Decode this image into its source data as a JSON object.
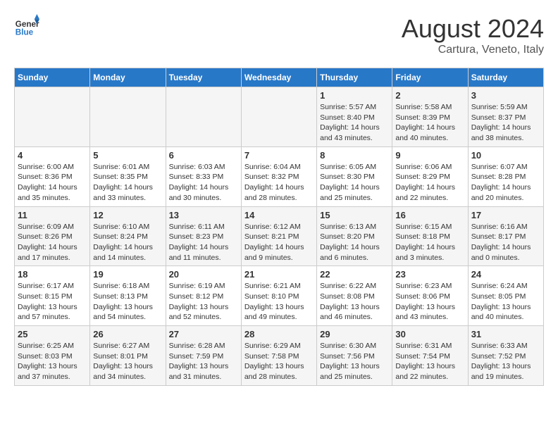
{
  "header": {
    "logo_line1": "General",
    "logo_line2": "Blue",
    "month": "August 2024",
    "location": "Cartura, Veneto, Italy"
  },
  "weekdays": [
    "Sunday",
    "Monday",
    "Tuesday",
    "Wednesday",
    "Thursday",
    "Friday",
    "Saturday"
  ],
  "weeks": [
    [
      {
        "day": "",
        "info": ""
      },
      {
        "day": "",
        "info": ""
      },
      {
        "day": "",
        "info": ""
      },
      {
        "day": "",
        "info": ""
      },
      {
        "day": "1",
        "info": "Sunrise: 5:57 AM\nSunset: 8:40 PM\nDaylight: 14 hours\nand 43 minutes."
      },
      {
        "day": "2",
        "info": "Sunrise: 5:58 AM\nSunset: 8:39 PM\nDaylight: 14 hours\nand 40 minutes."
      },
      {
        "day": "3",
        "info": "Sunrise: 5:59 AM\nSunset: 8:37 PM\nDaylight: 14 hours\nand 38 minutes."
      }
    ],
    [
      {
        "day": "4",
        "info": "Sunrise: 6:00 AM\nSunset: 8:36 PM\nDaylight: 14 hours\nand 35 minutes."
      },
      {
        "day": "5",
        "info": "Sunrise: 6:01 AM\nSunset: 8:35 PM\nDaylight: 14 hours\nand 33 minutes."
      },
      {
        "day": "6",
        "info": "Sunrise: 6:03 AM\nSunset: 8:33 PM\nDaylight: 14 hours\nand 30 minutes."
      },
      {
        "day": "7",
        "info": "Sunrise: 6:04 AM\nSunset: 8:32 PM\nDaylight: 14 hours\nand 28 minutes."
      },
      {
        "day": "8",
        "info": "Sunrise: 6:05 AM\nSunset: 8:30 PM\nDaylight: 14 hours\nand 25 minutes."
      },
      {
        "day": "9",
        "info": "Sunrise: 6:06 AM\nSunset: 8:29 PM\nDaylight: 14 hours\nand 22 minutes."
      },
      {
        "day": "10",
        "info": "Sunrise: 6:07 AM\nSunset: 8:28 PM\nDaylight: 14 hours\nand 20 minutes."
      }
    ],
    [
      {
        "day": "11",
        "info": "Sunrise: 6:09 AM\nSunset: 8:26 PM\nDaylight: 14 hours\nand 17 minutes."
      },
      {
        "day": "12",
        "info": "Sunrise: 6:10 AM\nSunset: 8:24 PM\nDaylight: 14 hours\nand 14 minutes."
      },
      {
        "day": "13",
        "info": "Sunrise: 6:11 AM\nSunset: 8:23 PM\nDaylight: 14 hours\nand 11 minutes."
      },
      {
        "day": "14",
        "info": "Sunrise: 6:12 AM\nSunset: 8:21 PM\nDaylight: 14 hours\nand 9 minutes."
      },
      {
        "day": "15",
        "info": "Sunrise: 6:13 AM\nSunset: 8:20 PM\nDaylight: 14 hours\nand 6 minutes."
      },
      {
        "day": "16",
        "info": "Sunrise: 6:15 AM\nSunset: 8:18 PM\nDaylight: 14 hours\nand 3 minutes."
      },
      {
        "day": "17",
        "info": "Sunrise: 6:16 AM\nSunset: 8:17 PM\nDaylight: 14 hours\nand 0 minutes."
      }
    ],
    [
      {
        "day": "18",
        "info": "Sunrise: 6:17 AM\nSunset: 8:15 PM\nDaylight: 13 hours\nand 57 minutes."
      },
      {
        "day": "19",
        "info": "Sunrise: 6:18 AM\nSunset: 8:13 PM\nDaylight: 13 hours\nand 54 minutes."
      },
      {
        "day": "20",
        "info": "Sunrise: 6:19 AM\nSunset: 8:12 PM\nDaylight: 13 hours\nand 52 minutes."
      },
      {
        "day": "21",
        "info": "Sunrise: 6:21 AM\nSunset: 8:10 PM\nDaylight: 13 hours\nand 49 minutes."
      },
      {
        "day": "22",
        "info": "Sunrise: 6:22 AM\nSunset: 8:08 PM\nDaylight: 13 hours\nand 46 minutes."
      },
      {
        "day": "23",
        "info": "Sunrise: 6:23 AM\nSunset: 8:06 PM\nDaylight: 13 hours\nand 43 minutes."
      },
      {
        "day": "24",
        "info": "Sunrise: 6:24 AM\nSunset: 8:05 PM\nDaylight: 13 hours\nand 40 minutes."
      }
    ],
    [
      {
        "day": "25",
        "info": "Sunrise: 6:25 AM\nSunset: 8:03 PM\nDaylight: 13 hours\nand 37 minutes."
      },
      {
        "day": "26",
        "info": "Sunrise: 6:27 AM\nSunset: 8:01 PM\nDaylight: 13 hours\nand 34 minutes."
      },
      {
        "day": "27",
        "info": "Sunrise: 6:28 AM\nSunset: 7:59 PM\nDaylight: 13 hours\nand 31 minutes."
      },
      {
        "day": "28",
        "info": "Sunrise: 6:29 AM\nSunset: 7:58 PM\nDaylight: 13 hours\nand 28 minutes."
      },
      {
        "day": "29",
        "info": "Sunrise: 6:30 AM\nSunset: 7:56 PM\nDaylight: 13 hours\nand 25 minutes."
      },
      {
        "day": "30",
        "info": "Sunrise: 6:31 AM\nSunset: 7:54 PM\nDaylight: 13 hours\nand 22 minutes."
      },
      {
        "day": "31",
        "info": "Sunrise: 6:33 AM\nSunset: 7:52 PM\nDaylight: 13 hours\nand 19 minutes."
      }
    ]
  ]
}
